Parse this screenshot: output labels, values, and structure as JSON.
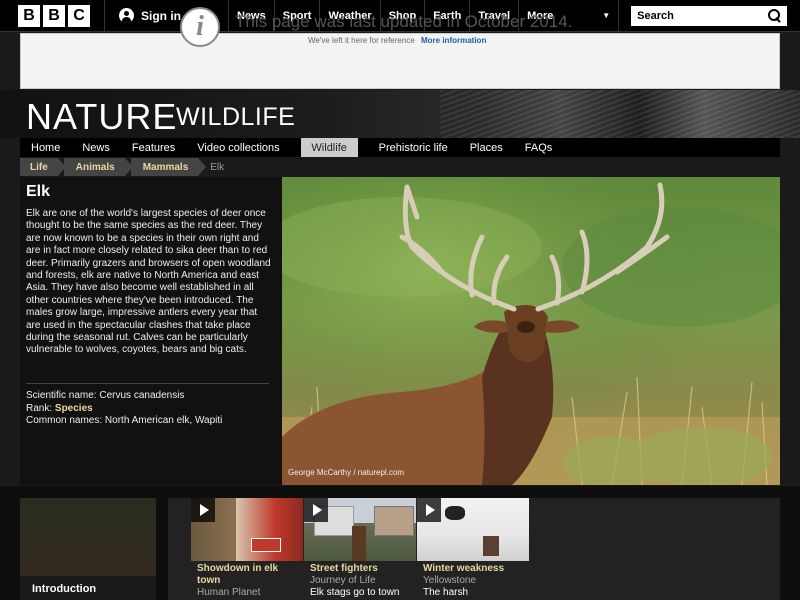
{
  "header": {
    "logo_letters": [
      "B",
      "B",
      "C"
    ],
    "signin_label": "Sign in",
    "nav": [
      "News",
      "Sport",
      "Weather",
      "Shop",
      "Earth",
      "Travel"
    ],
    "more_label": "More",
    "search_placeholder": "Search"
  },
  "notice": {
    "icon_glyph": "i",
    "title": "This page was last updated in October 2014.",
    "sub": "We've left it here for reference",
    "link": "More information"
  },
  "brand": {
    "title": "NATURE",
    "subtitle": "WILDLIFE"
  },
  "section_nav": [
    "Home",
    "News",
    "Features",
    "Video collections",
    "Wildlife",
    "Prehistoric life",
    "Places",
    "FAQs"
  ],
  "section_nav_active": "Wildlife",
  "breadcrumb": {
    "items": [
      "Life",
      "Animals",
      "Mammals"
    ],
    "current": "Elk"
  },
  "article": {
    "title": "Elk",
    "description": "Elk are one of the world's largest species of deer once thought to be the same species as the red deer. They are now known to be a species in their own right and are in fact more closely related to sika deer than to red deer. Primarily grazers and browsers of open woodland and forests, elk are native to North America and east Asia. They have also become well established in all other countries where they've been introduced. The males grow large, impressive antlers every year that are used in the spectacular clashes that take place during the seasonal rut. Calves can be particularly vulnerable to wolves, coyotes, bears and big cats.",
    "scientific_label": "Scientific name:",
    "scientific_value": "Cervus canadensis",
    "rank_label": "Rank:",
    "rank_value": "Species",
    "common_label": "Common names:",
    "common_value": "North American elk, Wapiti",
    "photo_credit": "George McCarthy / naturepl.com"
  },
  "bottom": {
    "intro_label": "Introduction",
    "cards": [
      {
        "title": "Showdown in elk town",
        "sub": "Human Planet",
        "desc": ""
      },
      {
        "title": "Street fighters",
        "sub": "Journey of Life",
        "desc": "Elk stags go to town"
      },
      {
        "title": "Winter weakness",
        "sub": "Yellowstone",
        "desc": "The harsh"
      }
    ]
  },
  "colors": {
    "accent_link": "#e9d9a0",
    "notice_link": "#1d5fb0",
    "active_tab_bg": "#cccccc"
  }
}
